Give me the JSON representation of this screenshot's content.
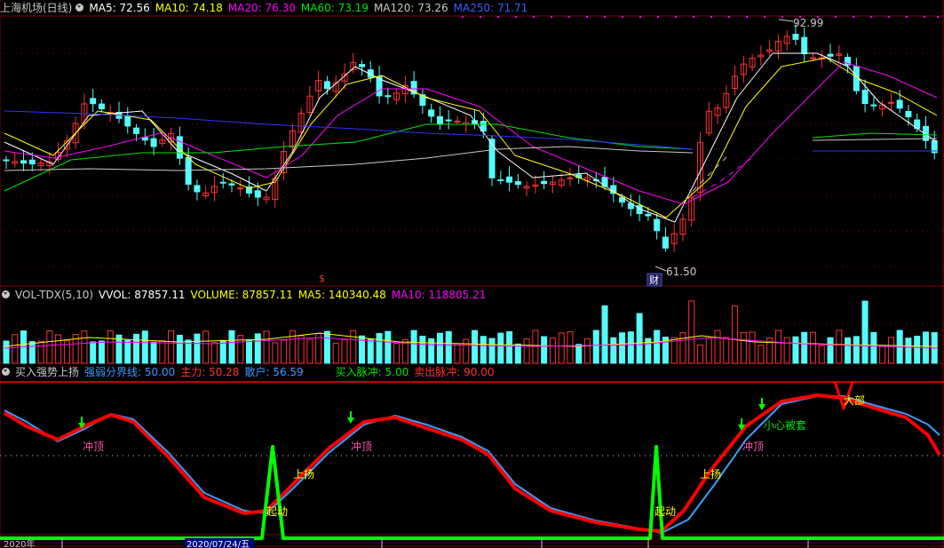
{
  "colors": {
    "bg": "#000000",
    "up": "#ff3232",
    "down": "#54fcfc",
    "grid": "#800000",
    "ma5": "#ffffff",
    "ma10": "#ffff00",
    "ma20": "#ff00ff",
    "ma60": "#00e600",
    "ma120": "#c8c8c8",
    "ma250": "#3232ff",
    "strong": "#ff0000",
    "weak": "#3c9cff",
    "pulse": "#00ff00"
  },
  "price_panel": {
    "title": "上海机场(日线)",
    "ma5": "MA5: 72.56",
    "ma10": "MA10: 74.18",
    "ma20": "MA20: 76.30",
    "ma60": "MA60: 73.19",
    "ma120": "MA120: 73.26",
    "ma250": "MA250: 71.71",
    "high_label": "92.99",
    "low_label": "61.50",
    "event_badge": "财",
    "marker_s": "$"
  },
  "volume_panel": {
    "name": "VOL-TDX(5,10)",
    "vvol": "VVOL: 87857.11",
    "volume": "VOLUME: 87857.11",
    "ma5": "MA5: 140340.48",
    "ma10": "MA10: 118805.21"
  },
  "indicator_panel": {
    "name": "买入强势上扬",
    "divider": "强弱分界线: 50.00",
    "main_force": "主力: 50.28",
    "retail": "散户: 56.59",
    "buy_pulse": "买入脉冲: 5.00",
    "sell_pulse": "卖出脉冲: 90.00"
  },
  "annotations": [
    "冲顶",
    "上扬",
    "起动",
    "冲顶",
    "上扬",
    "起动",
    "冲顶",
    "小心被套",
    "大部"
  ],
  "bottom_axis": {
    "left_label": "2020年",
    "date_box": "2020/07/24/五"
  },
  "chart_data": {
    "type": "candlestick",
    "price_extremes": {
      "high": 92.99,
      "low": 61.5
    },
    "indicator_levels": {
      "divider": 50.0,
      "buy_pulse": 5.0,
      "sell_pulse": 90.0
    }
  }
}
